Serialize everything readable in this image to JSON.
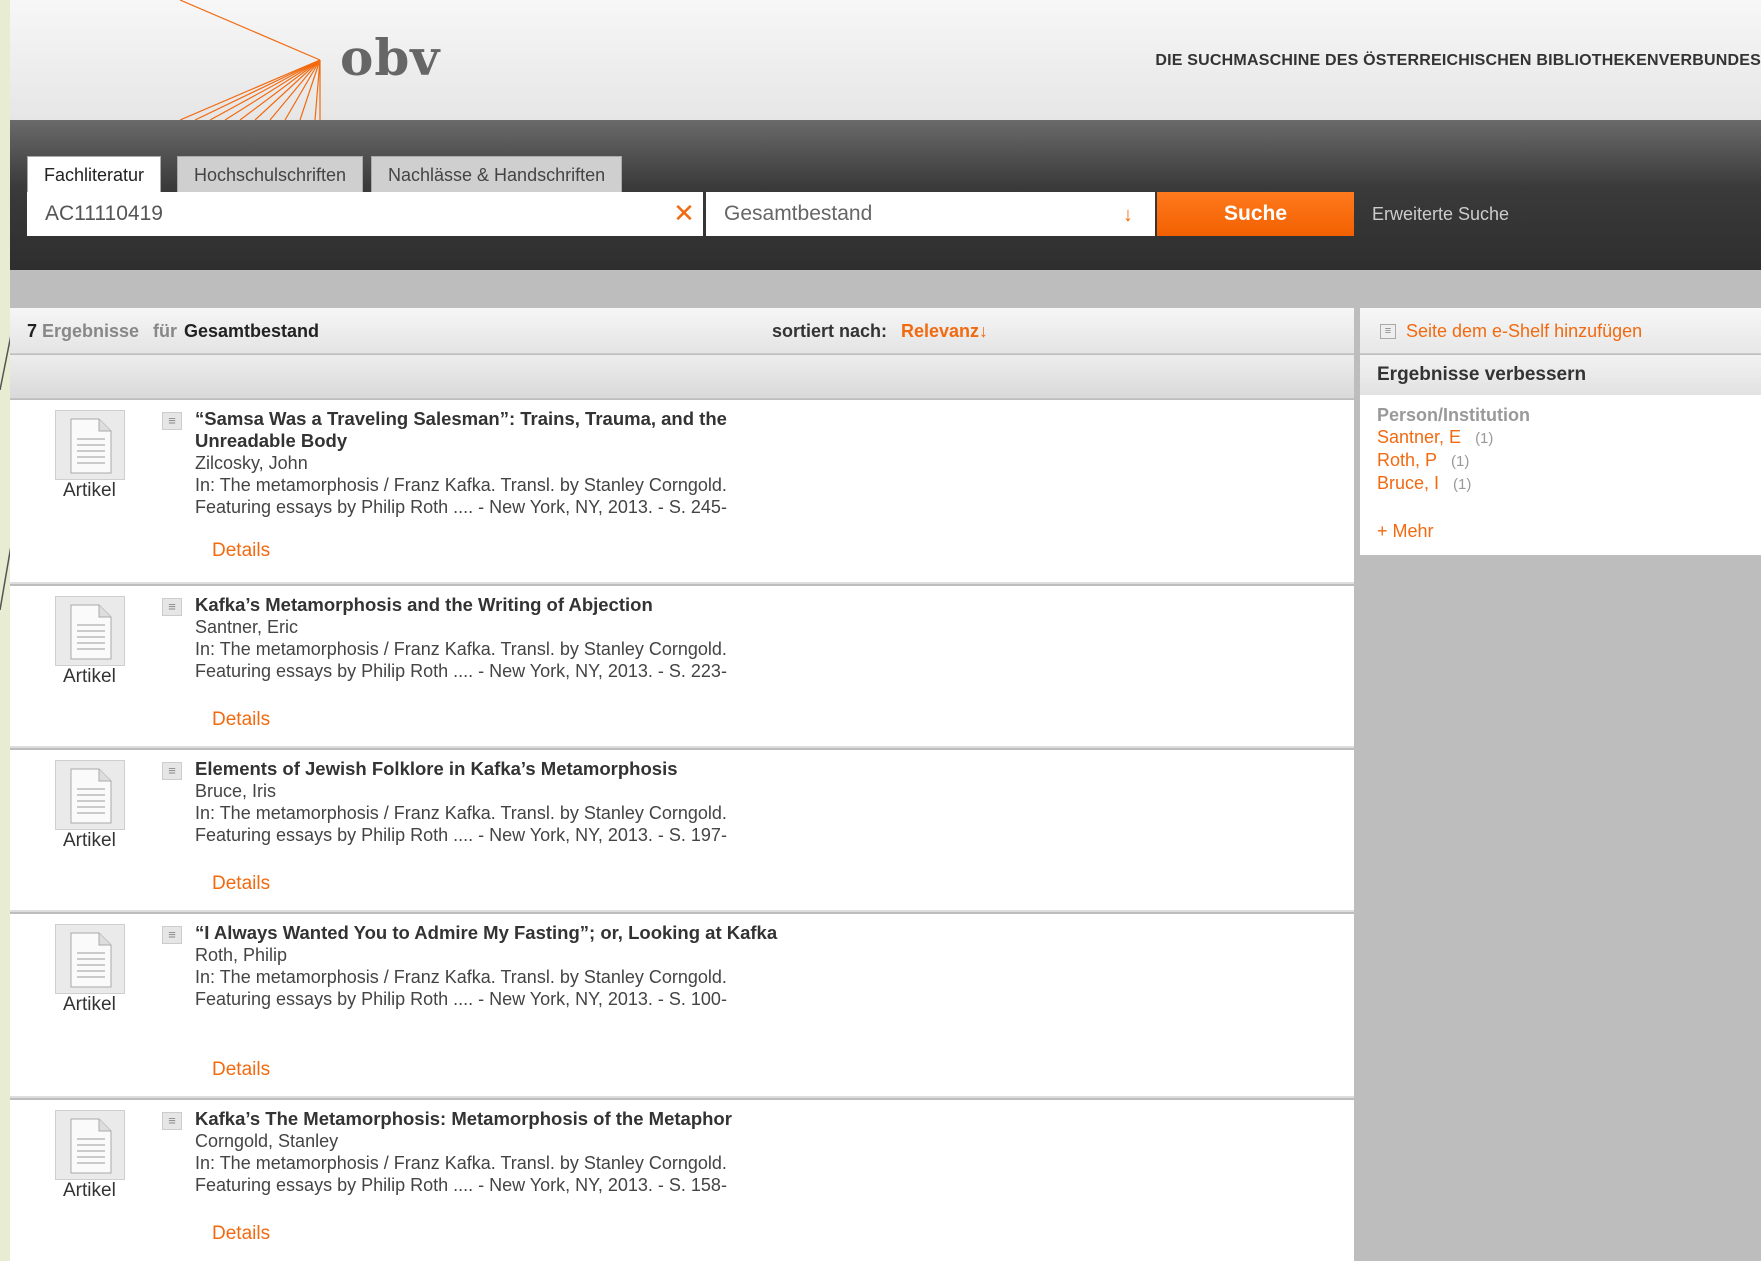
{
  "header": {
    "logo": "obv",
    "tagline": "DIE SUCHMASCHINE DES ÖSTERREICHISCHEN BIBLIOTHEKENVERBUNDES"
  },
  "tabs": [
    {
      "label": "Fachliteratur",
      "active": true
    },
    {
      "label": "Hochschulschriften",
      "active": false
    },
    {
      "label": "Nachlässe & Handschriften",
      "active": false
    }
  ],
  "search": {
    "value": "AC11110419",
    "clear_icon": "close-icon",
    "scope": "Gesamtbestand",
    "button": "Suche",
    "advanced": "Erweiterte Suche"
  },
  "results_bar": {
    "count": "7",
    "label": "Ergebnisse",
    "fuer": "für",
    "scope": "Gesamtbestand",
    "sort_label": "sortiert nach:",
    "sort_value": "Relevanz↓"
  },
  "results": [
    {
      "type": "Artikel",
      "title": "“Samsa Was a Traveling Salesman”: Trains, Trauma, and the Unreadable Body",
      "author": "Zilcosky, John",
      "source": "In: The metamorphosis / Franz Kafka. Transl. by Stanley Corngold. Featuring essays by Philip Roth .... - New York, NY, 2013. - S. 245-",
      "details": "Details"
    },
    {
      "type": "Artikel",
      "title": "Kafka’s Metamorphosis and the Writing of Abjection",
      "author": "Santner, Eric",
      "source": "In: The metamorphosis / Franz Kafka. Transl. by Stanley Corngold. Featuring essays by Philip Roth .... - New York, NY, 2013. - S. 223-",
      "details": "Details"
    },
    {
      "type": "Artikel",
      "title": "Elements of Jewish Folklore in Kafka’s Metamorphosis",
      "author": "Bruce, Iris",
      "source": "In: The metamorphosis / Franz Kafka. Transl. by Stanley Corngold. Featuring essays by Philip Roth .... - New York, NY, 2013. - S. 197-",
      "details": "Details"
    },
    {
      "type": "Artikel",
      "title": "“I Always Wanted You to Admire My Fasting”; or, Looking at Kafka",
      "author": "Roth, Philip",
      "source": "In: The metamorphosis / Franz Kafka. Transl. by Stanley Corngold. Featuring essays by Philip Roth .... - New York, NY, 2013. - S. 100-",
      "details": "Details"
    },
    {
      "type": "Artikel",
      "title": "Kafka’s The Metamorphosis: Metamorphosis of the Metaphor",
      "author": "Corngold, Stanley",
      "source": "In: The metamorphosis / Franz Kafka. Transl. by Stanley Corngold. Featuring essays by Philip Roth .... - New York, NY, 2013. - S. 158-",
      "details": "Details"
    }
  ],
  "right_panel": {
    "shelf_link": "Seite dem e-Shelf hinzufügen",
    "heading": "Ergebnisse verbessern",
    "section": "Person/Institution",
    "facets": [
      {
        "label": "Santner, E",
        "count": "(1)"
      },
      {
        "label": "Roth, P",
        "count": "(1)"
      },
      {
        "label": "Bruce, I",
        "count": "(1)"
      }
    ],
    "more": "+ Mehr"
  },
  "colors": {
    "accent": "#f26a10",
    "search_bar": "#3a3a3a",
    "panel_bg": "#bdbdbd"
  }
}
